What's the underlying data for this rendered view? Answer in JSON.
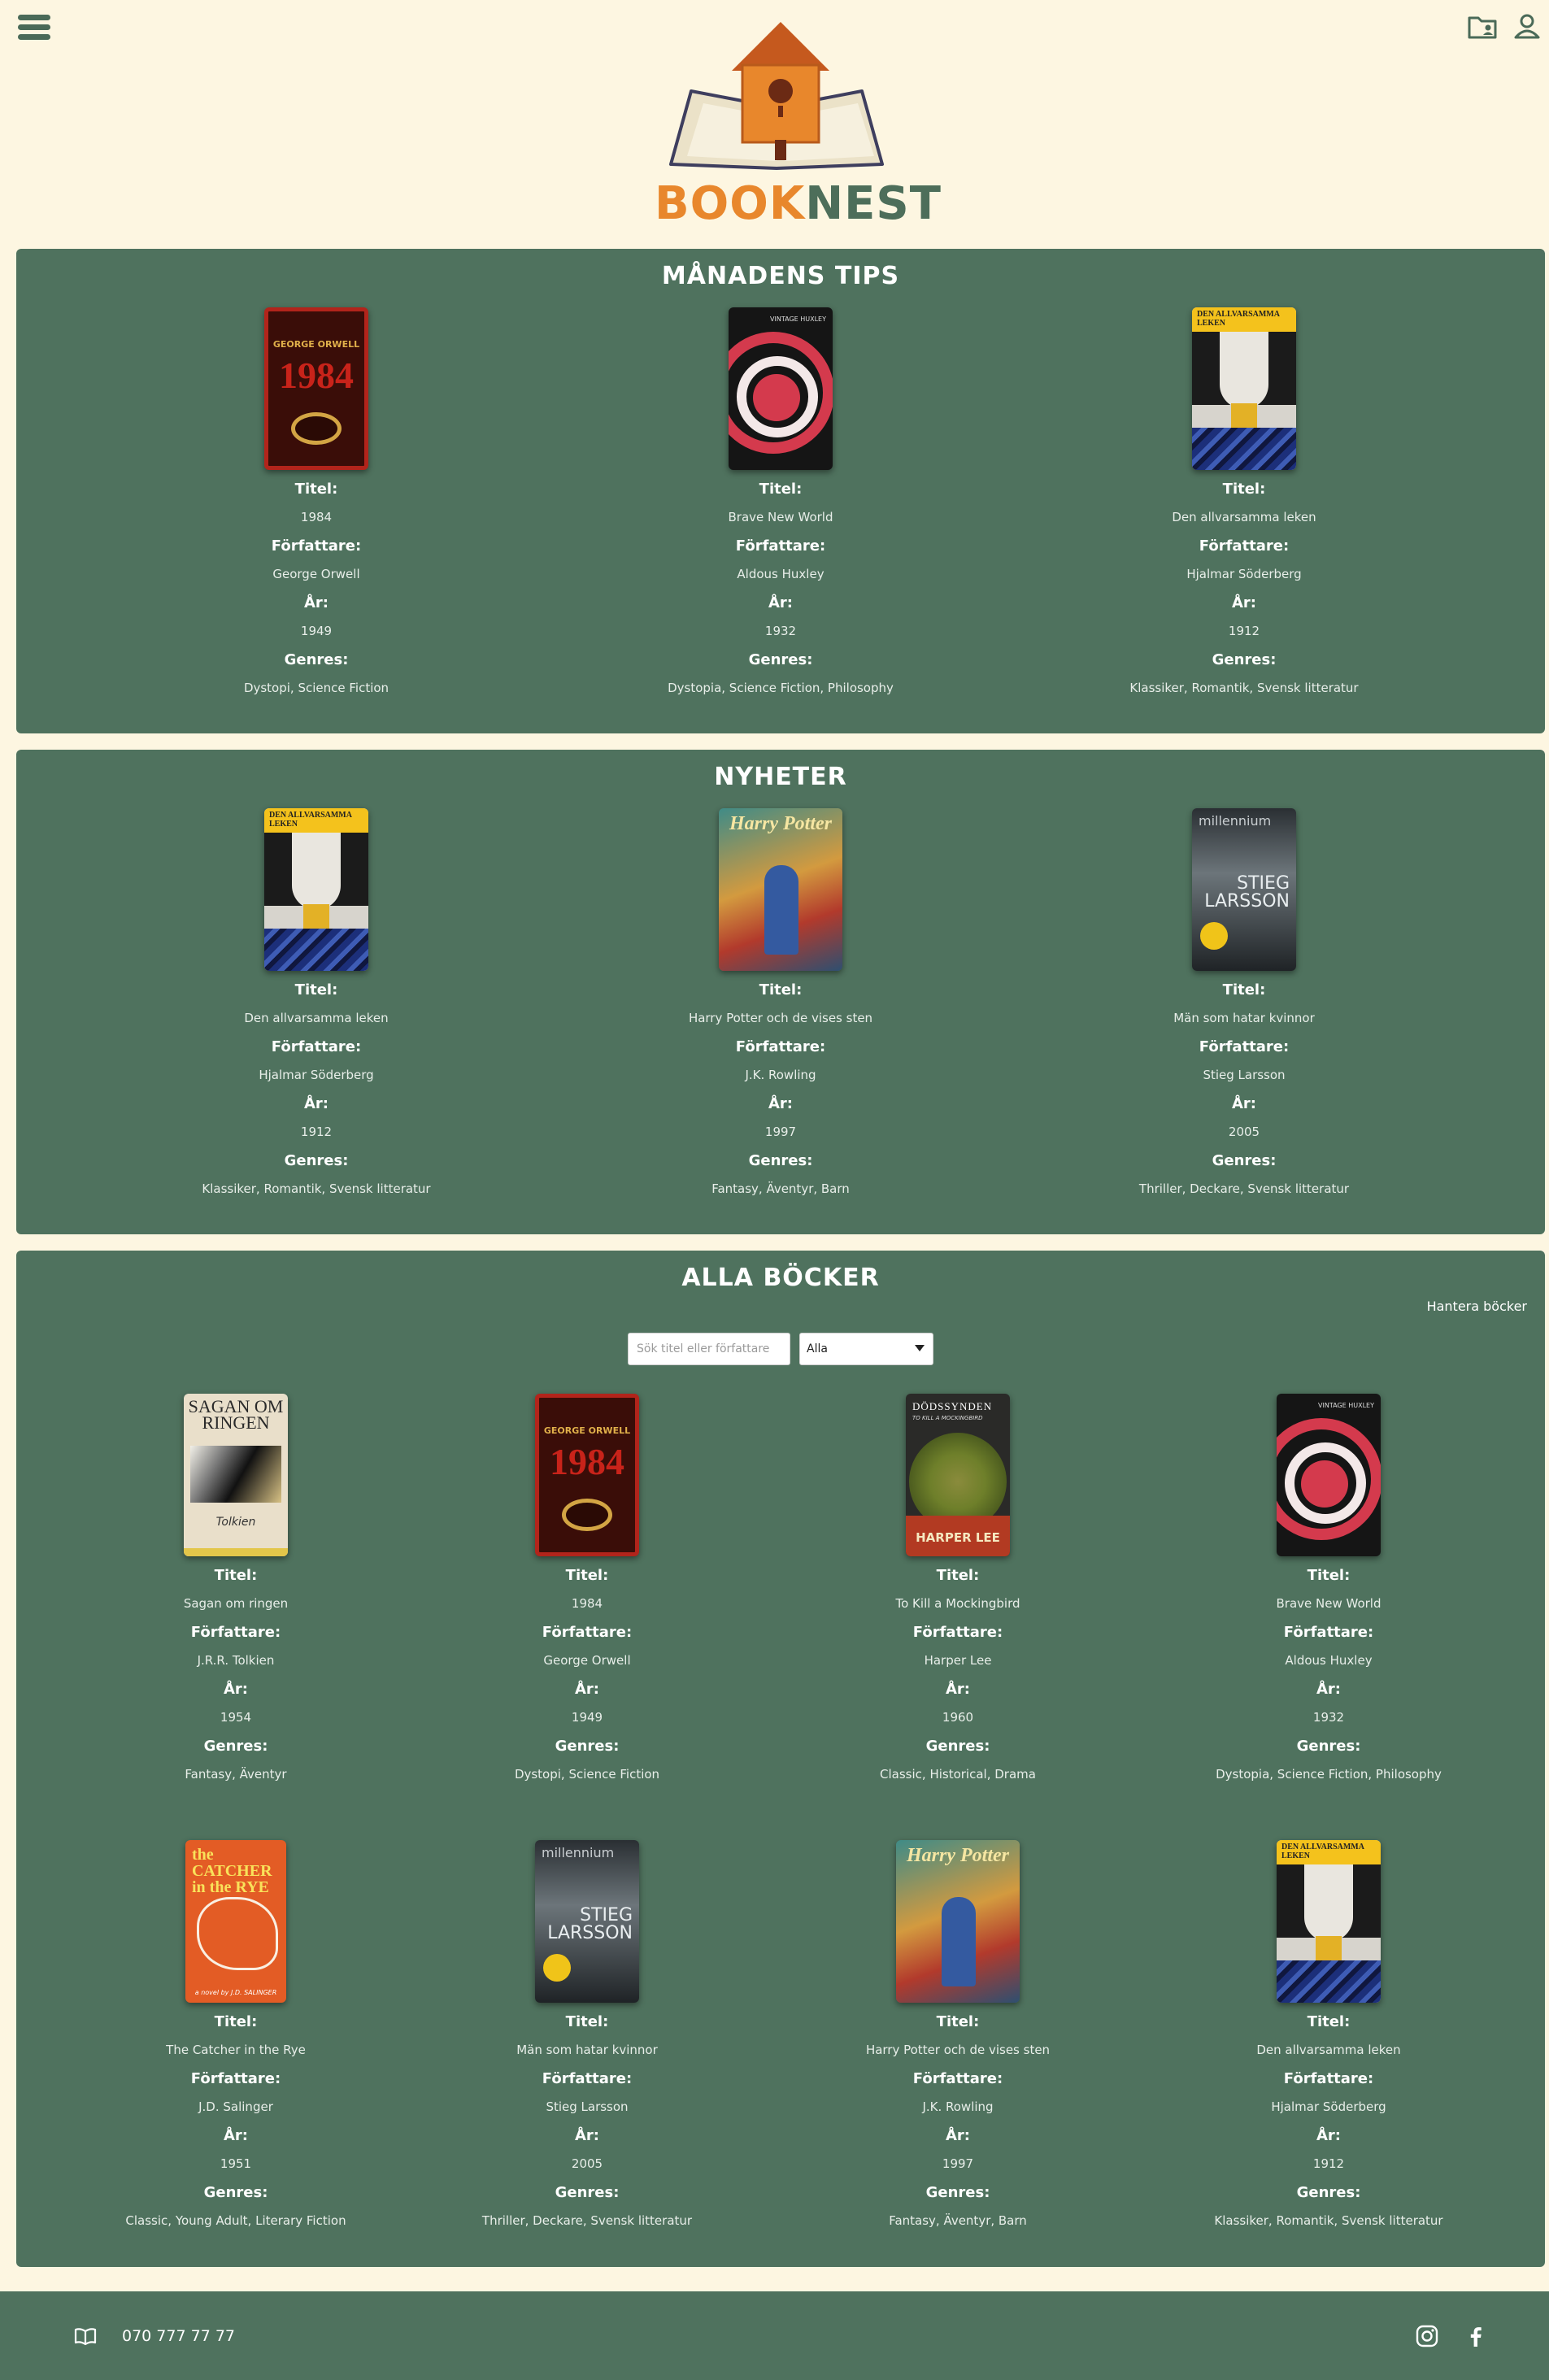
{
  "header": {
    "logo_part1": "BOOK",
    "logo_part2": "NEST",
    "menu_icon": "hamburger-menu-icon",
    "folder_icon": "folder-user-icon",
    "user_icon": "user-icon"
  },
  "colors": {
    "background": "#fdf6e1",
    "section": "#4f725e",
    "accent_orange": "#e8872c",
    "accent_green": "#4d6e5a"
  },
  "labels": {
    "title": "Titel:",
    "author": "Författare:",
    "year": "År:",
    "genres": "Genres:"
  },
  "monthly": {
    "heading": "MÅNADENS TIPS",
    "books": [
      {
        "title": "1984",
        "author": "George Orwell",
        "year": "1949",
        "genres": "Dystopi, Science Fiction",
        "cover_text": "GEORGE ORWELL",
        "cover_big": "1984"
      },
      {
        "title": "Brave New World",
        "author": "Aldous Huxley",
        "year": "1932",
        "genres": "Dystopia, Science Fiction, Philosophy",
        "cover_text": "VINTAGE HUXLEY"
      },
      {
        "title": "Den allvarsamma leken",
        "author": "Hjalmar Söderberg",
        "year": "1912",
        "genres": "Klassiker, Romantik, Svensk litteratur",
        "cover_text": "DEN ALLVARSAMMA LEKEN"
      }
    ]
  },
  "news": {
    "heading": "NYHETER",
    "books": [
      {
        "title": "Den allvarsamma leken",
        "author": "Hjalmar Söderberg",
        "year": "1912",
        "genres": "Klassiker, Romantik, Svensk litteratur",
        "cover_text": "DEN ALLVARSAMMA LEKEN"
      },
      {
        "title": "Harry Potter och de vises sten",
        "author": "J.K. Rowling",
        "year": "1997",
        "genres": "Fantasy, Äventyr, Barn",
        "cover_text": "Harry Potter"
      },
      {
        "title": "Män som hatar kvinnor",
        "author": "Stieg Larsson",
        "year": "2005",
        "genres": "Thriller, Deckare, Svensk litteratur",
        "cover_text": "millennium",
        "cover_big": "STIEG LARSSON"
      }
    ]
  },
  "all": {
    "heading": "ALLA BÖCKER",
    "manage_label": "Hantera böcker",
    "search_placeholder": "Sök titel eller författare",
    "filter_selected": "Alla",
    "books": [
      {
        "title": "Sagan om ringen",
        "author": "J.R.R. Tolkien",
        "year": "1954",
        "genres": "Fantasy, Äventyr",
        "cover_text": "SAGAN OM RINGEN"
      },
      {
        "title": "1984",
        "author": "George Orwell",
        "year": "1949",
        "genres": "Dystopi, Science Fiction",
        "cover_text": "GEORGE ORWELL",
        "cover_big": "1984"
      },
      {
        "title": "To Kill a Mockingbird",
        "author": "Harper Lee",
        "year": "1960",
        "genres": "Classic, Historical, Drama",
        "cover_text": "DÖDSSYNDEN",
        "cover_sub": "TO KILL A MOCKINGBIRD",
        "cover_author": "HARPER LEE"
      },
      {
        "title": "Brave New World",
        "author": "Aldous Huxley",
        "year": "1932",
        "genres": "Dystopia, Science Fiction, Philosophy",
        "cover_text": "VINTAGE HUXLEY"
      },
      {
        "title": "The Catcher in the Rye",
        "author": "J.D. Salinger",
        "year": "1951",
        "genres": "Classic, Young Adult, Literary Fiction",
        "cover_text": "the CATCHER in the RYE",
        "cover_author": "a novel by J.D. SALINGER"
      },
      {
        "title": "Män som hatar kvinnor",
        "author": "Stieg Larsson",
        "year": "2005",
        "genres": "Thriller, Deckare, Svensk litteratur",
        "cover_text": "millennium",
        "cover_big": "STIEG LARSSON"
      },
      {
        "title": "Harry Potter och de vises sten",
        "author": "J.K. Rowling",
        "year": "1997",
        "genres": "Fantasy, Äventyr, Barn",
        "cover_text": "Harry Potter"
      },
      {
        "title": "Den allvarsamma leken",
        "author": "Hjalmar Söderberg",
        "year": "1912",
        "genres": "Klassiker, Romantik, Svensk litteratur",
        "cover_text": "DEN ALLVARSAMMA LEKEN"
      }
    ]
  },
  "footer": {
    "phone": "070 777 77 77",
    "book_icon": "open-book-icon",
    "instagram_icon": "instagram-icon",
    "facebook_icon": "facebook-icon"
  }
}
